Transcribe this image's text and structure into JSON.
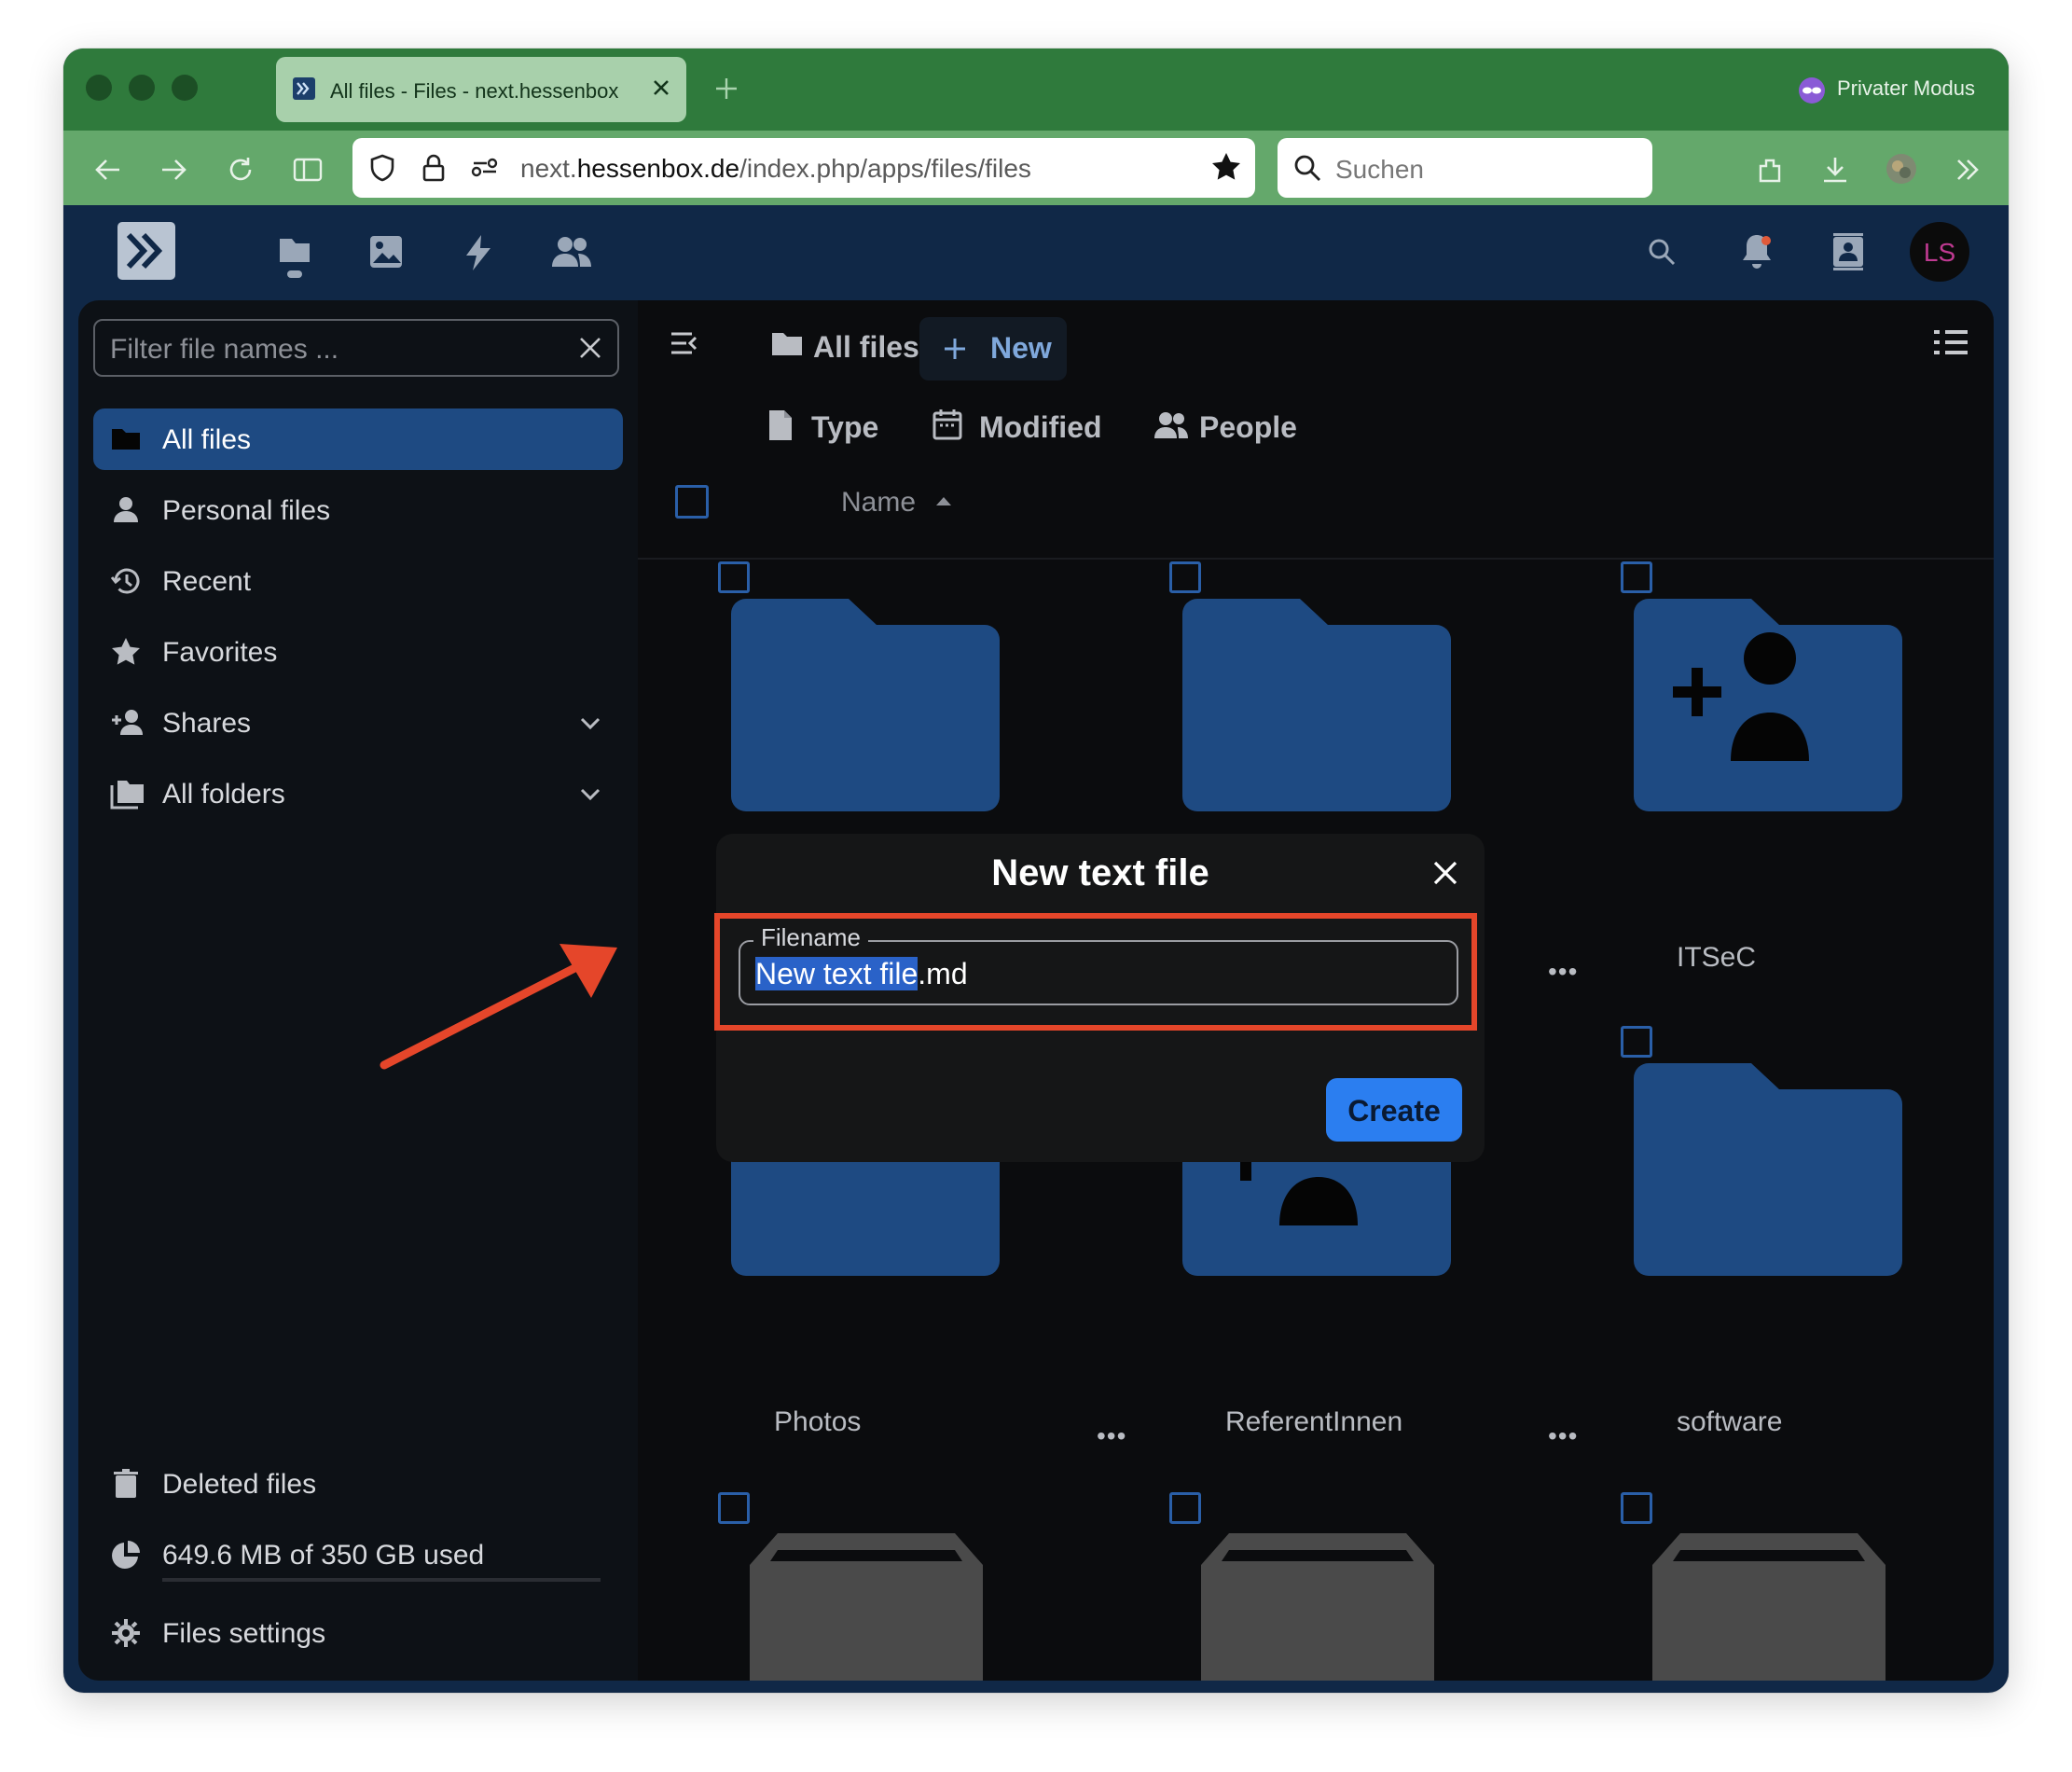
{
  "browser": {
    "tab_title": "All files - Files - next.hessenbox",
    "private_mode_label": "Privater Modus",
    "url_prefix": "next.",
    "url_domain": "hessenbox.de",
    "url_path": "/index.php/apps/files/files",
    "search_placeholder": "Suchen"
  },
  "nextcloud": {
    "avatar_initials": "LS",
    "accent_color": "#1e4a82"
  },
  "sidebar": {
    "filter_placeholder": "Filter file names ...",
    "items": [
      {
        "label": "All files",
        "icon": "folder-icon",
        "active": true
      },
      {
        "label": "Personal files",
        "icon": "person-icon"
      },
      {
        "label": "Recent",
        "icon": "history-icon"
      },
      {
        "label": "Favorites",
        "icon": "star-icon"
      },
      {
        "label": "Shares",
        "icon": "share-icon",
        "expandable": true
      },
      {
        "label": "All folders",
        "icon": "folders-icon",
        "expandable": true
      }
    ],
    "deleted_label": "Deleted files",
    "quota_label": "649.6 MB of 350 GB used",
    "settings_label": "Files settings"
  },
  "toolbar": {
    "breadcrumb": "All files",
    "new_label": "New",
    "filters": [
      "Type",
      "Modified",
      "People"
    ],
    "sort_label": "Name"
  },
  "files": [
    {
      "name": "",
      "shared": false
    },
    {
      "name": "",
      "shared": false
    },
    {
      "name": "ITSeC",
      "shared": true
    },
    {
      "name": "Photos",
      "shared": false
    },
    {
      "name": "ReferentInnen",
      "shared": true
    },
    {
      "name": "software",
      "shared": false
    }
  ],
  "dialog": {
    "title": "New text file",
    "field_label": "Filename",
    "selected_text": "New text file",
    "extension": ".md",
    "create_label": "Create"
  }
}
